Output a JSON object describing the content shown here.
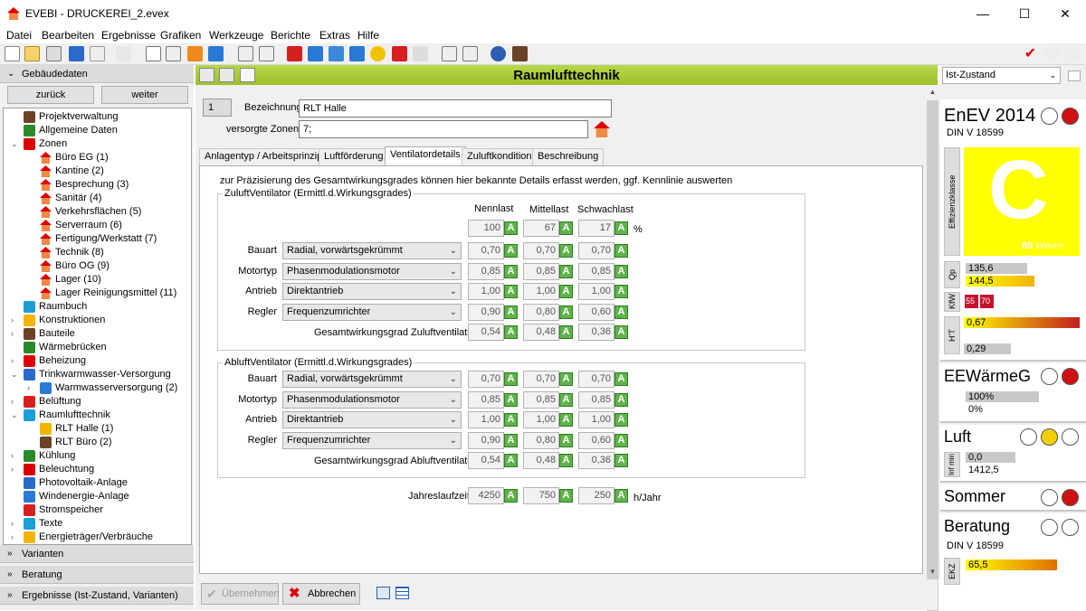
{
  "window": {
    "title": "EVEBI - DRUCKEREI_2.evex",
    "minimize": "—",
    "maximize": "☐",
    "close": "✕"
  },
  "menu": [
    "Datei",
    "Bearbeiten",
    "Ergebnisse",
    "Grafiken",
    "Werkzeuge",
    "Berichte",
    "Extras",
    "Hilfe"
  ],
  "left": {
    "header": "Gebäudedaten",
    "back": "zurück",
    "forward": "weiter",
    "tree": [
      {
        "label": "Projektverwaltung",
        "level": 0,
        "exp": ""
      },
      {
        "label": "Allgemeine Daten",
        "level": 0,
        "exp": ""
      },
      {
        "label": "Zonen",
        "level": 0,
        "exp": "v"
      },
      {
        "label": "Büro EG (1)",
        "level": 1,
        "exp": ""
      },
      {
        "label": "Kantine (2)",
        "level": 1,
        "exp": ""
      },
      {
        "label": "Besprechung (3)",
        "level": 1,
        "exp": ""
      },
      {
        "label": "Sanitär (4)",
        "level": 1,
        "exp": ""
      },
      {
        "label": "Verkehrsflächen (5)",
        "level": 1,
        "exp": ""
      },
      {
        "label": "Serverraum (6)",
        "level": 1,
        "exp": ""
      },
      {
        "label": "Fertigung/Werkstatt (7)",
        "level": 1,
        "exp": ""
      },
      {
        "label": "Technik (8)",
        "level": 1,
        "exp": ""
      },
      {
        "label": "Büro OG (9)",
        "level": 1,
        "exp": ""
      },
      {
        "label": "Lager (10)",
        "level": 1,
        "exp": ""
      },
      {
        "label": "Lager Reinigungsmittel (11)",
        "level": 1,
        "exp": ""
      },
      {
        "label": "Raumbuch",
        "level": 0,
        "exp": ""
      },
      {
        "label": "Konstruktionen",
        "level": 0,
        "exp": ">"
      },
      {
        "label": "Bauteile",
        "level": 0,
        "exp": ">"
      },
      {
        "label": "Wärmebrücken",
        "level": 0,
        "exp": ""
      },
      {
        "label": "Beheizung",
        "level": 0,
        "exp": ">"
      },
      {
        "label": "Trinkwarmwasser-Versorgung",
        "level": 0,
        "exp": "v"
      },
      {
        "label": "Warmwasserversorgung (2)",
        "level": 1,
        "exp": ">"
      },
      {
        "label": "Belüftung",
        "level": 0,
        "exp": ">"
      },
      {
        "label": "Raumlufttechnik",
        "level": 0,
        "exp": "v"
      },
      {
        "label": "RLT Halle (1)",
        "level": 1,
        "exp": "",
        "selected": true
      },
      {
        "label": "RLT Büro (2)",
        "level": 1,
        "exp": ""
      },
      {
        "label": "Kühlung",
        "level": 0,
        "exp": ">"
      },
      {
        "label": "Beleuchtung",
        "level": 0,
        "exp": ">"
      },
      {
        "label": "Photovoltaik-Anlage",
        "level": 0,
        "exp": ""
      },
      {
        "label": "Windenergie-Anlage",
        "level": 0,
        "exp": ""
      },
      {
        "label": "Stromspeicher",
        "level": 0,
        "exp": ""
      },
      {
        "label": "Texte",
        "level": 0,
        "exp": ">"
      },
      {
        "label": "Energieträger/Verbräuche",
        "level": 0,
        "exp": ">"
      }
    ],
    "sections": [
      "Varianten",
      "Beratung",
      "Ergebnisse (Ist-Zustand, Varianten)"
    ]
  },
  "main": {
    "title": "Raumlufttechnik",
    "number": "1",
    "bezeichnung_label": "Bezeichnung",
    "bezeichnung": "RLT Halle",
    "zonen_label": "versorgte Zonen",
    "zonen": "7;",
    "tabs": [
      "Anlagentyp / Arbeitsprinzip",
      "Luftförderung",
      "Ventilatordetails",
      "Zuluftkondition",
      "Beschreibung"
    ],
    "hint": "zur Präzisierung des Gesamtwirkungsgrades können hier bekannte Details erfasst werden, ggf. Kennlinie auswerten",
    "col_heads": [
      "Nennlast",
      "Mittellast",
      "Schwachlast"
    ],
    "pct_values": [
      "100",
      "67",
      "17"
    ],
    "pct_unit": "%",
    "zuluft": {
      "title": "ZuluftVentilator (Ermittl.d.Wirkungsgrades)",
      "rows": [
        {
          "label": "Bauart",
          "select": "Radial, vorwärtsgekrümmt",
          "vals": [
            "0,70",
            "0,70",
            "0,70"
          ]
        },
        {
          "label": "Motortyp",
          "select": "Phasenmodulationsmotor",
          "vals": [
            "0,85",
            "0,85",
            "0,85"
          ]
        },
        {
          "label": "Antrieb",
          "select": "Direktantrieb",
          "vals": [
            "1,00",
            "1,00",
            "1,00"
          ]
        },
        {
          "label": "Regler",
          "select": "Frequenzumrichter",
          "vals": [
            "0,90",
            "0,80",
            "0,60"
          ]
        }
      ],
      "total_label": "Gesamtwirkungsgrad Zuluftventilator",
      "total": [
        "0,54",
        "0,48",
        "0,36"
      ]
    },
    "abluft": {
      "title": "AbluftVentilator (Ermittl.d.Wirkungsgrades)",
      "rows": [
        {
          "label": "Bauart",
          "select": "Radial, vorwärtsgekrümmt",
          "vals": [
            "0,70",
            "0,70",
            "0,70"
          ]
        },
        {
          "label": "Motortyp",
          "select": "Phasenmodulationsmotor",
          "vals": [
            "0,85",
            "0,85",
            "0,85"
          ]
        },
        {
          "label": "Antrieb",
          "select": "Direktantrieb",
          "vals": [
            "1,00",
            "1,00",
            "1,00"
          ]
        },
        {
          "label": "Regler",
          "select": "Frequenzumrichter",
          "vals": [
            "0,90",
            "0,80",
            "0,60"
          ]
        }
      ],
      "total_label": "Gesamtwirkungsgrad Abluftventilator",
      "total": [
        "0,54",
        "0,48",
        "0,36"
      ]
    },
    "jahres_label": "Jahreslaufzeit",
    "jahres": [
      "4250",
      "750",
      "250"
    ],
    "jahres_unit": "h/Jahr",
    "apply": "Übernehmen",
    "cancel": "Abbrechen",
    "a_letter": "A"
  },
  "right": {
    "state": "Ist-Zustand",
    "enev": {
      "title": "EnEV 2014",
      "norm": "DIN V 18599",
      "class": "C",
      "value": "89",
      "unit": "kWh/m²",
      "label": "Effizienzklasse"
    },
    "qp": {
      "label": "Qp",
      "v1": "135,6",
      "v2": "144,5"
    },
    "kw": {
      "label": "KfW",
      "v1": "55",
      "v2": "70"
    },
    "ht": {
      "label": "H'T",
      "v1": "0,67",
      "v2": "0,29"
    },
    "eew": {
      "title": "EEWärmeG",
      "v1": "100%",
      "v2": "0%"
    },
    "luft": {
      "title": "Luft",
      "label": "Inf min",
      "v1": "0,0",
      "v2": "1412,5"
    },
    "sommer": {
      "title": "Sommer"
    },
    "beratung": {
      "title": "Beratung",
      "norm": "DIN V 18599",
      "label": "EKZ",
      "v1": "65,5"
    }
  }
}
